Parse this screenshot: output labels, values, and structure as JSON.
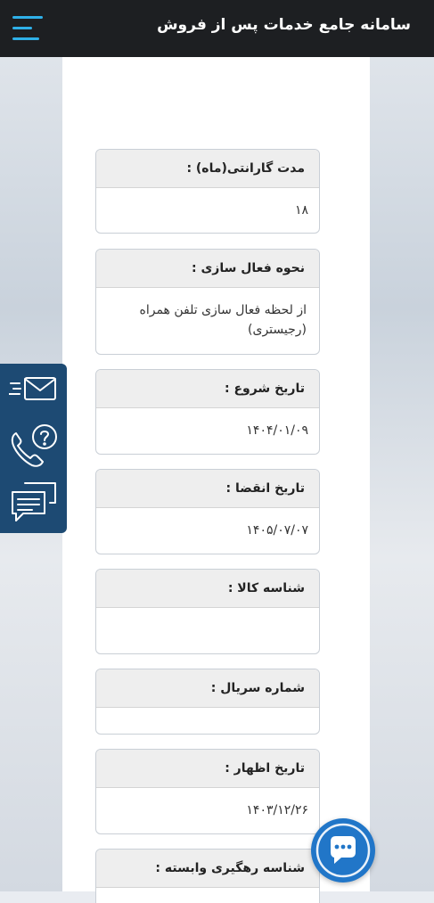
{
  "header": {
    "title": "سامانه جامع خدمات پس از فروش",
    "menu_icon": "hamburger-menu-icon",
    "accent": "#2fb0e8"
  },
  "fields": [
    {
      "label": "مدت گارانتی(ماه) :",
      "value": "۱۸"
    },
    {
      "label": "نحوه فعال سازی :",
      "value": "از لحظه فعال سازی تلفن همراه (رجیستری)"
    },
    {
      "label": "تاریخ شروع :",
      "value": "۱۴۰۴/۰۱/۰۹"
    },
    {
      "label": "تاریخ انقضا :",
      "value": "۱۴۰۵/۰۷/۰۷"
    },
    {
      "label": "شناسه کالا :",
      "value": ""
    },
    {
      "label": "شماره سریال :",
      "value": ""
    },
    {
      "label": "تاریخ اظهار :",
      "value": "۱۴۰۳/۱۲/۲۶"
    },
    {
      "label": "شناسه رهگیری وابسته :",
      "value": ""
    }
  ],
  "side_panel": {
    "icons": [
      "email-icon",
      "phone-help-icon",
      "chat-message-icon"
    ],
    "color": "#1d4a73"
  },
  "chat_fab": {
    "icon": "chat-bubble-icon",
    "color": "#2176c8"
  }
}
